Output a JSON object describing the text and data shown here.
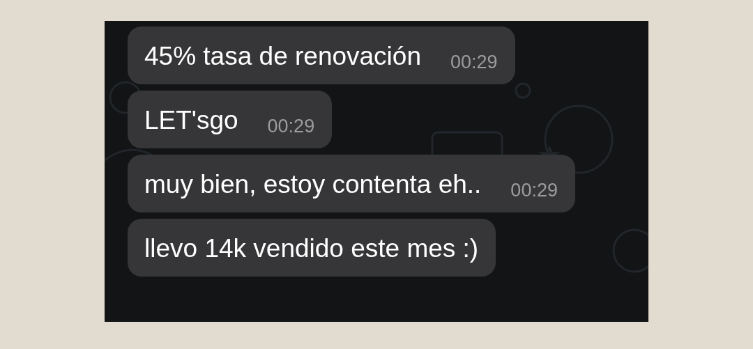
{
  "messages": [
    {
      "text": "45% tasa de renovación",
      "time": "00:29"
    },
    {
      "text": "LET'sgo",
      "time": "00:29"
    },
    {
      "text": "muy bien, estoy contenta eh..",
      "time": "00:29"
    },
    {
      "text": "llevo 14k vendido este mes :)"
    }
  ]
}
